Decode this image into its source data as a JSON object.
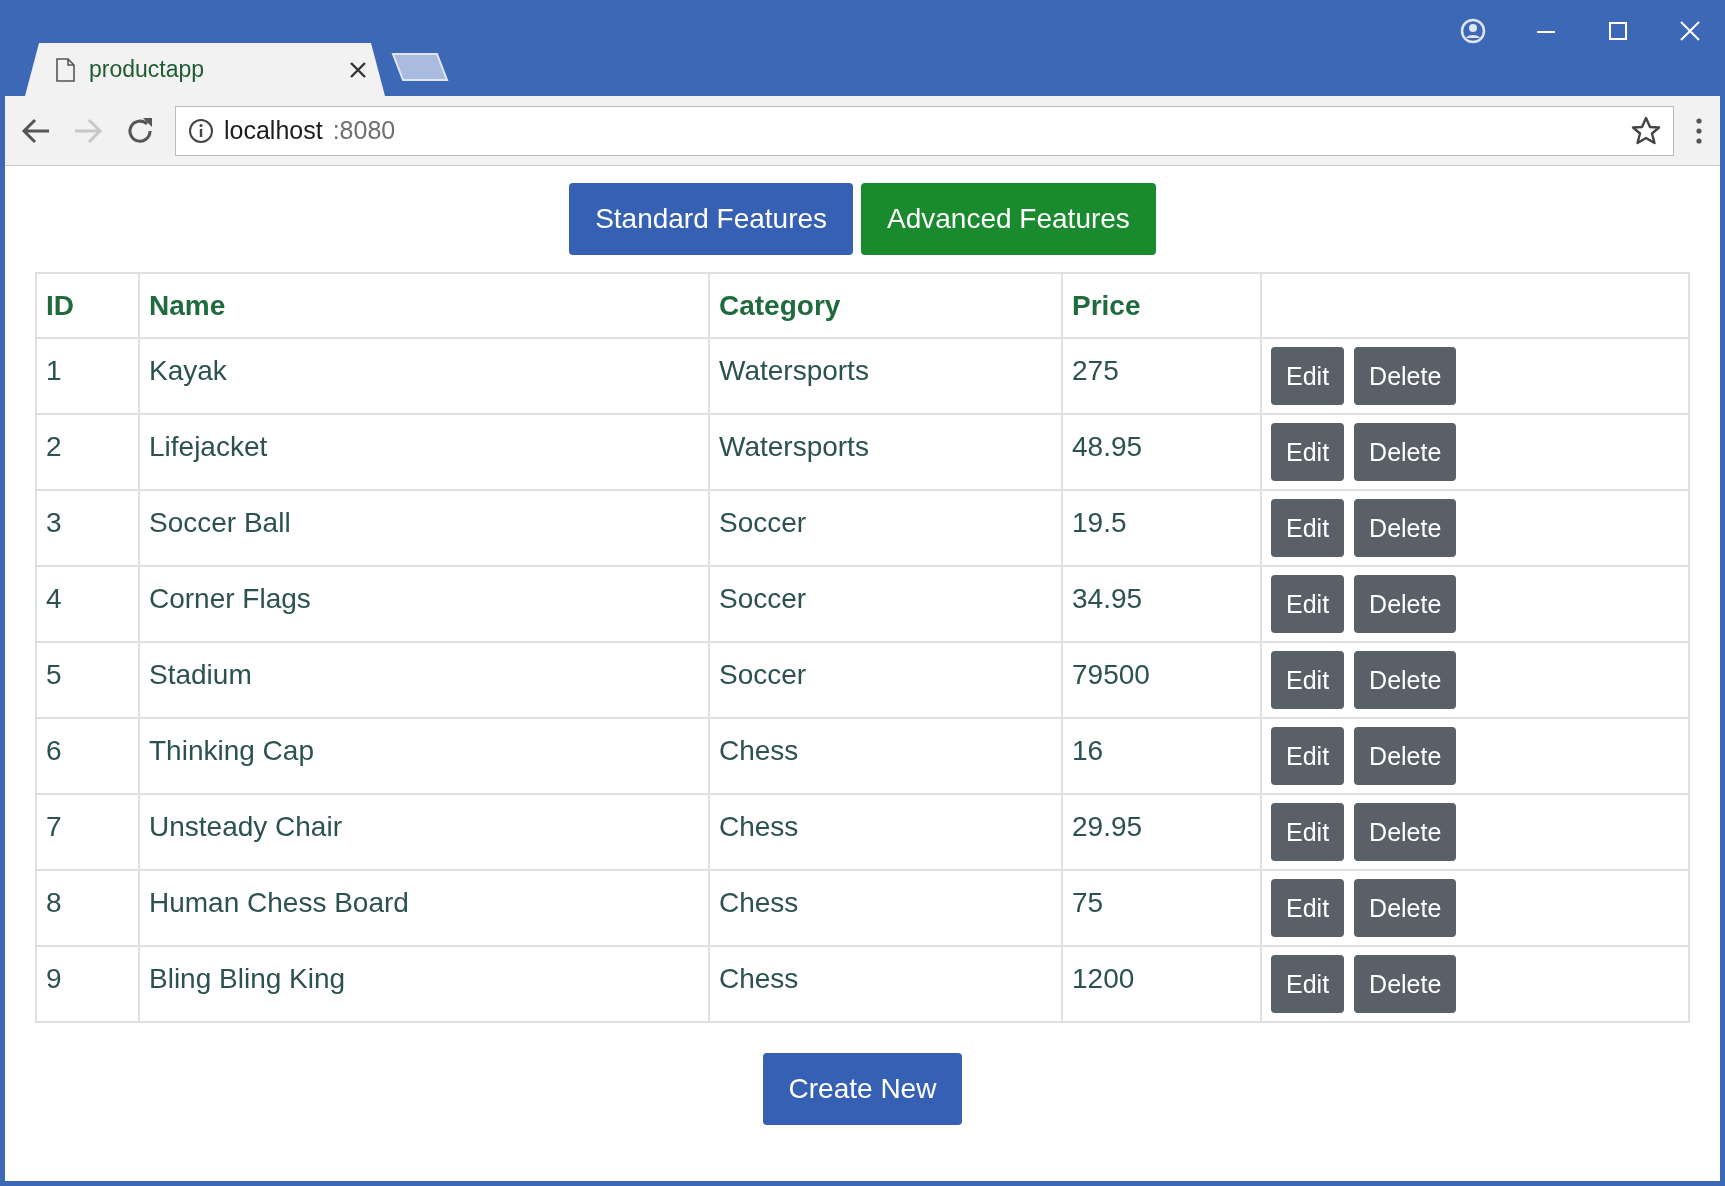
{
  "browser": {
    "tabs": [
      {
        "title": "productapp",
        "selected": true
      }
    ],
    "address": {
      "host": "localhost",
      "port": ":8080"
    }
  },
  "nav_buttons": [
    {
      "label": "Standard Features",
      "kind": "primary"
    },
    {
      "label": "Advanced Features",
      "kind": "success"
    }
  ],
  "table": {
    "columns": [
      "ID",
      "Name",
      "Category",
      "Price"
    ],
    "rows": [
      {
        "cells": [
          "1",
          "Kayak",
          "Watersports",
          "275"
        ],
        "actions": [
          "Edit",
          "Delete"
        ]
      },
      {
        "cells": [
          "2",
          "Lifejacket",
          "Watersports",
          "48.95"
        ],
        "actions": [
          "Edit",
          "Delete"
        ]
      },
      {
        "cells": [
          "3",
          "Soccer Ball",
          "Soccer",
          "19.5"
        ],
        "actions": [
          "Edit",
          "Delete"
        ]
      },
      {
        "cells": [
          "4",
          "Corner Flags",
          "Soccer",
          "34.95"
        ],
        "actions": [
          "Edit",
          "Delete"
        ]
      },
      {
        "cells": [
          "5",
          "Stadium",
          "Soccer",
          "79500"
        ],
        "actions": [
          "Edit",
          "Delete"
        ]
      },
      {
        "cells": [
          "6",
          "Thinking Cap",
          "Chess",
          "16"
        ],
        "actions": [
          "Edit",
          "Delete"
        ]
      },
      {
        "cells": [
          "7",
          "Unsteady Chair",
          "Chess",
          "29.95"
        ],
        "actions": [
          "Edit",
          "Delete"
        ]
      },
      {
        "cells": [
          "8",
          "Human Chess Board",
          "Chess",
          "75"
        ],
        "actions": [
          "Edit",
          "Delete"
        ]
      },
      {
        "cells": [
          "9",
          "Bling Bling King",
          "Chess",
          "1200"
        ],
        "actions": [
          "Edit",
          "Delete"
        ]
      }
    ]
  },
  "create_button": "Create New"
}
